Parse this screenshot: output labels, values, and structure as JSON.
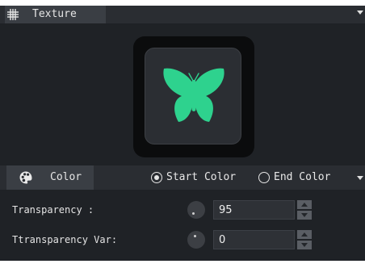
{
  "texture_section": {
    "tab_label": "Texture",
    "icon": "texture-grid-icon",
    "preview_icon": "butterfly-icon",
    "preview_color": "#2ed28e"
  },
  "color_section": {
    "tab_label": "Color",
    "icon": "palette-icon",
    "start_color_label": "Start Color",
    "end_color_label": "End Color",
    "selected": "Start Color"
  },
  "properties": {
    "transparency": {
      "label": "Transparency :",
      "value": "95"
    },
    "transparency_var": {
      "label": "Ttransparency Var:",
      "value": "0"
    }
  },
  "colors": {
    "panel_bg": "#1f2226",
    "header_bg": "#2a2d32",
    "tab_bg": "#3a3e44",
    "accent_green": "#2ed28e"
  }
}
